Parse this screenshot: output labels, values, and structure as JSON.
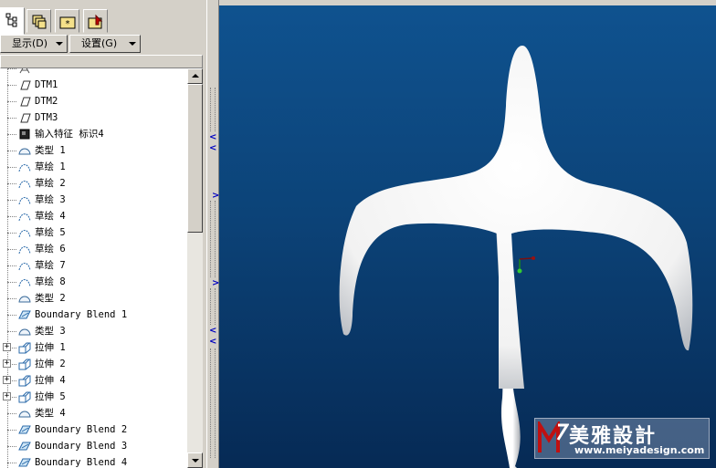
{
  "toolbar": {
    "tabs": [
      {
        "icon": "model-tree-icon",
        "active": true
      },
      {
        "icon": "layers-icon",
        "active": false
      },
      {
        "icon": "star-folder-icon",
        "active": false
      },
      {
        "icon": "favorites-icon",
        "active": false
      }
    ]
  },
  "menu": {
    "display_label": "显示(D)",
    "settings_label": "设置(G)"
  },
  "tree": {
    "items": [
      {
        "label": "",
        "icon": "coord-system-icon",
        "type": "coord",
        "expandable": false
      },
      {
        "label": "DTM1",
        "icon": "datum-plane-icon",
        "type": "plane",
        "expandable": false
      },
      {
        "label": "DTM2",
        "icon": "datum-plane-icon",
        "type": "plane",
        "expandable": false
      },
      {
        "label": "DTM3",
        "icon": "datum-plane-icon",
        "type": "plane",
        "expandable": false
      },
      {
        "label": "输入特征 标识4",
        "icon": "import-feature-icon",
        "type": "import",
        "expandable": false
      },
      {
        "label": "类型 1",
        "icon": "type-icon",
        "type": "type",
        "expandable": false
      },
      {
        "label": "草绘 1",
        "icon": "sketch-icon",
        "type": "sketch",
        "expandable": false
      },
      {
        "label": "草绘 2",
        "icon": "sketch-icon",
        "type": "sketch",
        "expandable": false
      },
      {
        "label": "草绘 3",
        "icon": "sketch-icon",
        "type": "sketch",
        "expandable": false
      },
      {
        "label": "草绘 4",
        "icon": "sketch-icon",
        "type": "sketch",
        "expandable": false
      },
      {
        "label": "草绘 5",
        "icon": "sketch-icon",
        "type": "sketch",
        "expandable": false
      },
      {
        "label": "草绘 6",
        "icon": "sketch-icon",
        "type": "sketch",
        "expandable": false
      },
      {
        "label": "草绘 7",
        "icon": "sketch-icon",
        "type": "sketch",
        "expandable": false
      },
      {
        "label": "草绘 8",
        "icon": "sketch-icon",
        "type": "sketch",
        "expandable": false
      },
      {
        "label": "类型 2",
        "icon": "type-icon",
        "type": "type",
        "expandable": false
      },
      {
        "label": "Boundary Blend 1",
        "icon": "boundary-blend-icon",
        "type": "blend",
        "expandable": false
      },
      {
        "label": "类型 3",
        "icon": "type-icon",
        "type": "type",
        "expandable": false
      },
      {
        "label": "拉伸 1",
        "icon": "extrude-icon",
        "type": "extrude",
        "expandable": true
      },
      {
        "label": "拉伸 2",
        "icon": "extrude-icon",
        "type": "extrude",
        "expandable": true
      },
      {
        "label": "拉伸 4",
        "icon": "extrude-icon",
        "type": "extrude",
        "expandable": true
      },
      {
        "label": "拉伸 5",
        "icon": "extrude-icon",
        "type": "extrude",
        "expandable": true
      },
      {
        "label": "类型 4",
        "icon": "type-icon",
        "type": "type",
        "expandable": false
      },
      {
        "label": "Boundary Blend 2",
        "icon": "boundary-blend-icon",
        "type": "blend",
        "expandable": false
      },
      {
        "label": "Boundary Blend 3",
        "icon": "boundary-blend-icon",
        "type": "blend",
        "expandable": false
      },
      {
        "label": "Boundary Blend 4",
        "icon": "boundary-blend-icon",
        "type": "blend",
        "expandable": false
      }
    ]
  },
  "viewport": {
    "background_top": "#0f528f",
    "background_bottom": "#062a55",
    "model_color": "#ffffff"
  },
  "watermark": {
    "title": "美雅設計",
    "url": "www.meiyadesign.com"
  }
}
